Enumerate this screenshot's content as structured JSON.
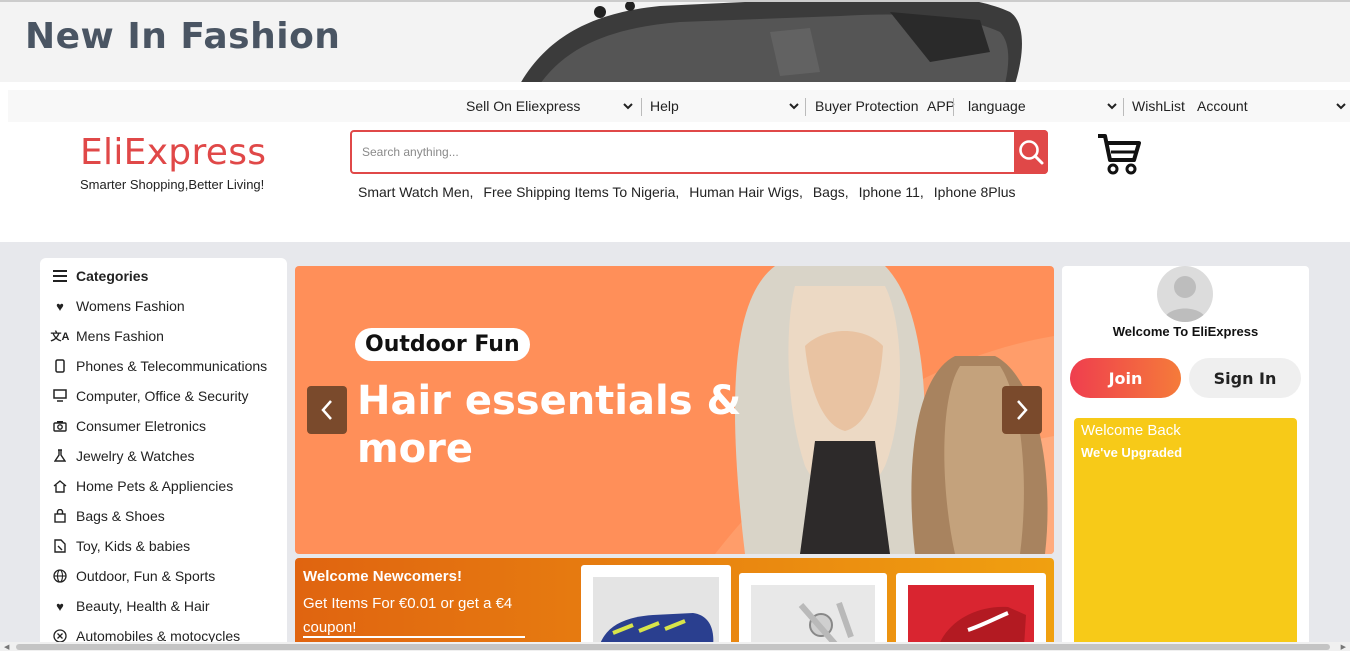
{
  "banner": {
    "title": "New In Fashion"
  },
  "util_bar": {
    "sell": "Sell On Eliexpress",
    "help": "Help",
    "buyer_protection": "Buyer Protection",
    "app": "APP",
    "language": "language",
    "wishlist": "WishList",
    "account": "Account"
  },
  "header": {
    "logo": "EliExpress",
    "tagline": "Smarter Shopping,Better Living!",
    "search_placeholder": "Search anything...",
    "suggestions": [
      "Smart Watch Men,",
      "Free Shipping Items To Nigeria,",
      "Human Hair Wigs,",
      "Bags,",
      "Iphone 11,",
      "Iphone 8Plus"
    ]
  },
  "categories": {
    "heading": "Categories",
    "items": [
      {
        "label": "Womens Fashion",
        "icon": "heart-icon"
      },
      {
        "label": "Mens Fashion",
        "icon": "translate-icon"
      },
      {
        "label": "Phones & Telecommunications",
        "icon": "phone-icon"
      },
      {
        "label": "Computer, Office & Security",
        "icon": "monitor-icon"
      },
      {
        "label": "Consumer Eletronics",
        "icon": "camera-icon"
      },
      {
        "label": "Jewelry & Watches",
        "icon": "flask-icon"
      },
      {
        "label": "Home Pets & Appliencies",
        "icon": "home-icon"
      },
      {
        "label": "Bags & Shoes",
        "icon": "bag-icon"
      },
      {
        "label": "Toy, Kids & babies",
        "icon": "toy-icon"
      },
      {
        "label": "Outdoor, Fun & Sports",
        "icon": "globe-icon"
      },
      {
        "label": "Beauty, Health & Hair",
        "icon": "heart-icon"
      },
      {
        "label": "Automobiles & motocycles",
        "icon": "x-circle-icon"
      }
    ]
  },
  "hero": {
    "tag": "Outdoor Fun",
    "line1": "Hair essentials &",
    "line2": "more"
  },
  "newcomers": {
    "title": "Welcome Newcomers!",
    "text": "Get Items For €0.01 or get a €4 coupon!"
  },
  "account_panel": {
    "welcome": "Welcome To EliExpress",
    "join": "Join",
    "sign_in": "Sign In",
    "promo_title": "Welcome Back",
    "promo_sub": "We've Upgraded"
  },
  "colors": {
    "brand_red": "#e04848",
    "hero_orange": "#ff8f59",
    "promo_yellow": "#f7ca18"
  }
}
